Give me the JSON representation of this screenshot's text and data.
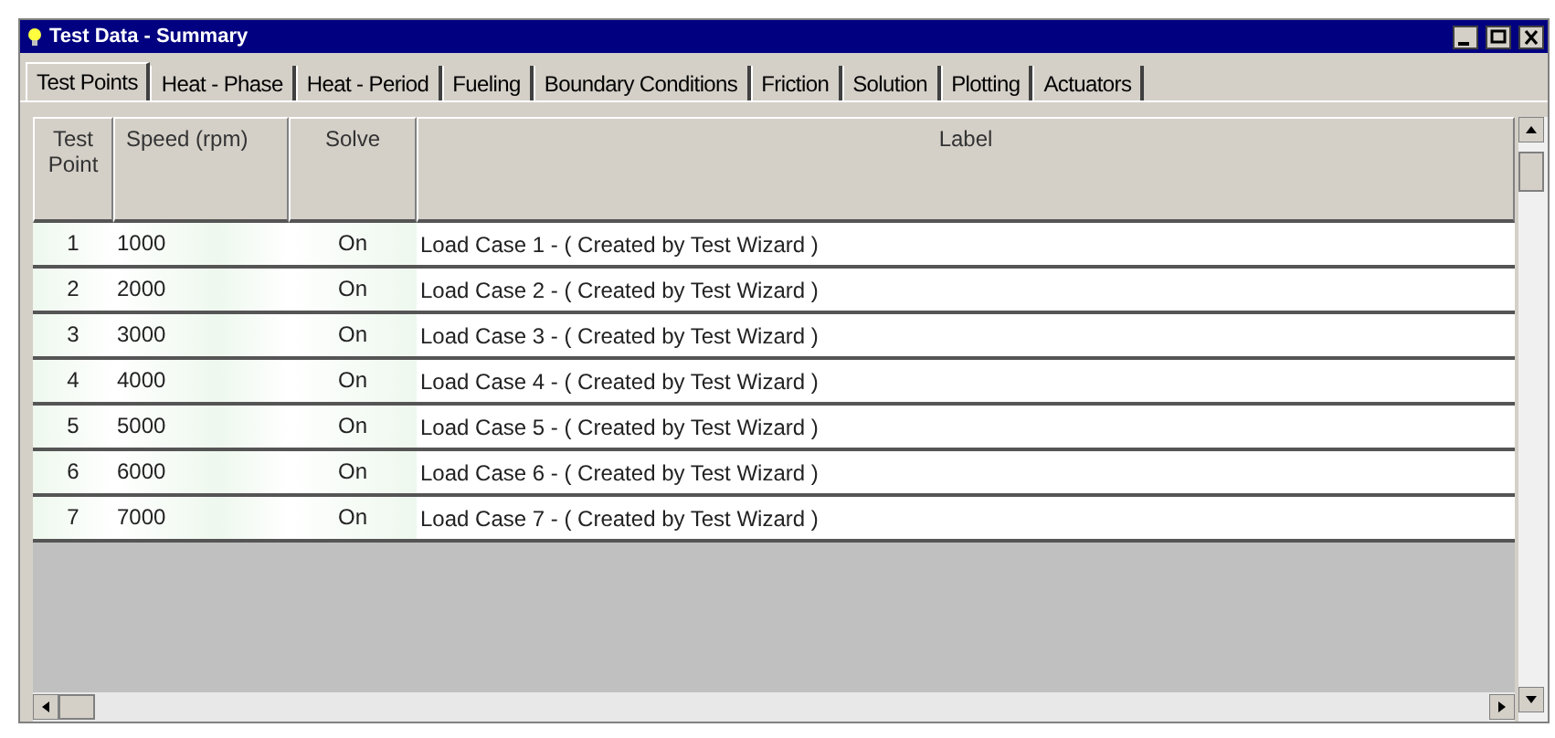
{
  "window": {
    "title": "Test Data - Summary"
  },
  "tabs": [
    {
      "label": "Test Points",
      "selected": true
    },
    {
      "label": "Heat - Phase",
      "selected": false
    },
    {
      "label": "Heat - Period",
      "selected": false
    },
    {
      "label": "Fueling",
      "selected": false
    },
    {
      "label": "Boundary Conditions",
      "selected": false
    },
    {
      "label": "Friction",
      "selected": false
    },
    {
      "label": "Solution",
      "selected": false
    },
    {
      "label": "Plotting",
      "selected": false
    },
    {
      "label": "Actuators",
      "selected": false
    }
  ],
  "table": {
    "columns": [
      "Test Point",
      "Speed (rpm)",
      "Solve",
      "Label"
    ],
    "rows": [
      [
        "1",
        "1000",
        "On",
        "Load Case 1 - ( Created by Test Wizard )"
      ],
      [
        "2",
        "2000",
        "On",
        "Load Case 2 - ( Created by Test Wizard )"
      ],
      [
        "3",
        "3000",
        "On",
        "Load Case 3 - ( Created by Test Wizard )"
      ],
      [
        "4",
        "4000",
        "On",
        "Load Case 4 - ( Created by Test Wizard )"
      ],
      [
        "5",
        "5000",
        "On",
        "Load Case 5 - ( Created by Test Wizard )"
      ],
      [
        "6",
        "6000",
        "On",
        "Load Case 6 - ( Created by Test Wizard )"
      ],
      [
        "7",
        "7000",
        "On",
        "Load Case 7 - ( Created by Test Wizard )"
      ]
    ]
  }
}
